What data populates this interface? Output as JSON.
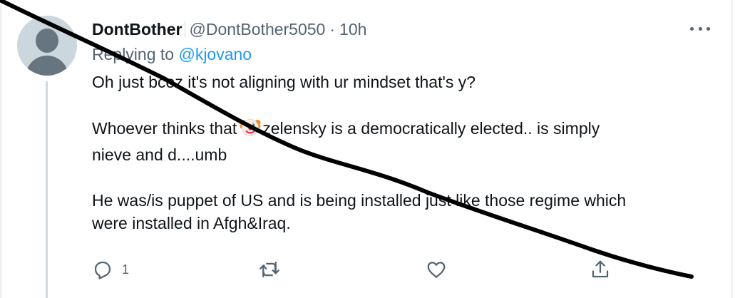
{
  "tweet": {
    "display_name": "DontBother",
    "handle": "@DontBother5050",
    "separator": "·",
    "time": "10h",
    "replying_prefix": "Replying to",
    "replying_to": "@kjovano",
    "paragraphs": [
      "Oh just bcoz it's not aligning with ur mindset that's y?",
      "Whoever thinks that",
      "zelensky is a democratically elected.. is simply",
      "nieve and d....umb",
      "He was/is puppet of US and is being installed just like those regime which",
      "were installed in Afgh&Iraq."
    ],
    "emoji": "clown-face-emoji"
  },
  "actions": {
    "reply": {
      "icon": "reply-icon",
      "count": "1"
    },
    "retweet": {
      "icon": "retweet-icon",
      "count": ""
    },
    "like": {
      "icon": "heart-icon",
      "count": ""
    },
    "share": {
      "icon": "share-icon"
    }
  },
  "colors": {
    "text": "#0f1419",
    "secondary": "#536471",
    "link": "#1d9bf0",
    "thread_line": "#cfd9de",
    "scribble": "#000000"
  }
}
